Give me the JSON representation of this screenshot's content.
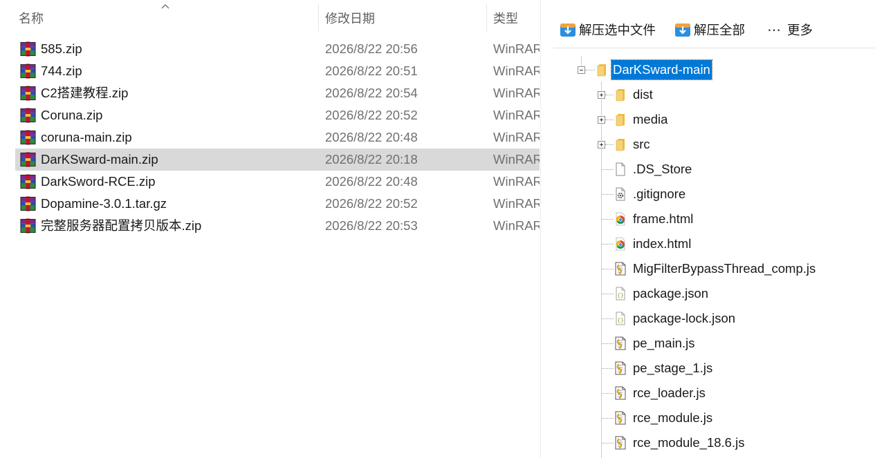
{
  "file_list": {
    "columns": {
      "name": "名称",
      "modified": "修改日期",
      "type": "类型"
    },
    "rows": [
      {
        "name": "585.zip",
        "modified": "2026/8/22 20:56",
        "type": "WinRAR",
        "selected": false
      },
      {
        "name": "744.zip",
        "modified": "2026/8/22 20:51",
        "type": "WinRAR",
        "selected": false
      },
      {
        "name": "C2搭建教程.zip",
        "modified": "2026/8/22 20:54",
        "type": "WinRAR",
        "selected": false
      },
      {
        "name": "Coruna.zip",
        "modified": "2026/8/22 20:52",
        "type": "WinRAR",
        "selected": false
      },
      {
        "name": "coruna-main.zip",
        "modified": "2026/8/22 20:48",
        "type": "WinRAR",
        "selected": false
      },
      {
        "name": "DarKSward-main.zip",
        "modified": "2026/8/22 20:18",
        "type": "WinRAR",
        "selected": true
      },
      {
        "name": "DarkSword-RCE.zip",
        "modified": "2026/8/22 20:48",
        "type": "WinRAR",
        "selected": false
      },
      {
        "name": "Dopamine-3.0.1.tar.gz",
        "modified": "2026/8/22 20:52",
        "type": "WinRAR",
        "selected": false
      },
      {
        "name": "完整服务器配置拷贝版本.zip",
        "modified": "2026/8/22 20:53",
        "type": "WinRAR",
        "selected": false
      }
    ]
  },
  "preview": {
    "toolbar": {
      "extract_selected": "解压选中文件",
      "extract_all": "解压全部",
      "more": "更多"
    },
    "tree": {
      "root": {
        "label": "DarKSward-main",
        "icon": "folder-icon",
        "expanded": true
      },
      "children": [
        {
          "label": "dist",
          "icon": "folder-icon",
          "expandable": true
        },
        {
          "label": "media",
          "icon": "folder-icon",
          "expandable": true
        },
        {
          "label": "src",
          "icon": "folder-icon",
          "expandable": true
        },
        {
          "label": ".DS_Store",
          "icon": "blank-file-icon",
          "expandable": false
        },
        {
          "label": ".gitignore",
          "icon": "gear-file-icon",
          "expandable": false
        },
        {
          "label": "frame.html",
          "icon": "chrome-html-icon",
          "expandable": false
        },
        {
          "label": "index.html",
          "icon": "chrome-html-icon",
          "expandable": false
        },
        {
          "label": "MigFilterBypassThread_comp.js",
          "icon": "script-file-icon",
          "expandable": false
        },
        {
          "label": "package.json",
          "icon": "json-file-icon",
          "expandable": false
        },
        {
          "label": "package-lock.json",
          "icon": "json-file-icon",
          "expandable": false
        },
        {
          "label": "pe_main.js",
          "icon": "script-file-icon",
          "expandable": false
        },
        {
          "label": "pe_stage_1.js",
          "icon": "script-file-icon",
          "expandable": false
        },
        {
          "label": "rce_loader.js",
          "icon": "script-file-icon",
          "expandable": false
        },
        {
          "label": "rce_module.js",
          "icon": "script-file-icon",
          "expandable": false
        },
        {
          "label": "rce_module_18.6.js",
          "icon": "script-file-icon",
          "expandable": false
        }
      ]
    }
  },
  "colors": {
    "selection_row": "#d9d9d9",
    "tree_selection": "#0078d7",
    "muted_text": "#707070"
  }
}
